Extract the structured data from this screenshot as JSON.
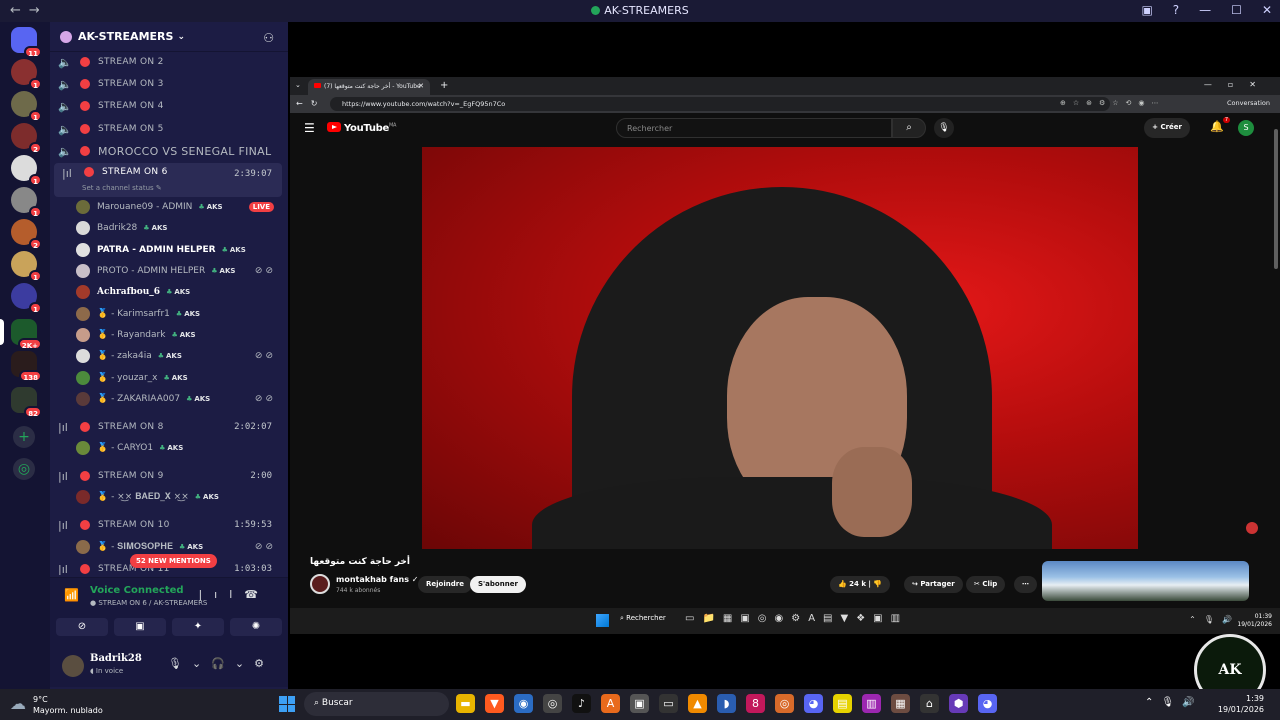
{
  "window": {
    "title": "AK-STREAMERS"
  },
  "rail": {
    "servers": [
      {
        "badge": "11"
      },
      {
        "badge": "1"
      },
      {
        "badge": "1"
      },
      {
        "badge": "2"
      },
      {
        "badge": "1"
      },
      {
        "badge": "1"
      },
      {
        "badge": "2"
      },
      {
        "badge": "1"
      },
      {
        "badge": "1"
      },
      {
        "badge": "2K+"
      },
      {
        "badge": "138"
      },
      {
        "badge": "82"
      }
    ]
  },
  "sidebar": {
    "guild_name": "AK-STREAMERS",
    "channels_top": [
      "STREAM ON 2",
      "STREAM ON 3",
      "STREAM ON 4",
      "STREAM ON 5",
      "MOROCCO VS SENEGAL FINAL"
    ],
    "active_channel": {
      "name": "STREAM ON 6",
      "time": "2:39:07",
      "status_hint": "Set a channel status"
    },
    "users_ch6": [
      {
        "name": "Marouane09 - ADMIN",
        "tag": "AKS",
        "live": "LIVE"
      },
      {
        "name": "Badrik28",
        "tag": "AKS"
      },
      {
        "name": "PATRA - ADMIN HELPER",
        "tag": "AKS"
      },
      {
        "name": "PROTO - ADMIN HELPER",
        "tag": "AKS"
      },
      {
        "name": "Achrafbou_6",
        "tag": "AKS"
      },
      {
        "name": "🥇 - Karimsarfr1",
        "tag": "AKS"
      },
      {
        "name": "🥇 - Rayandark",
        "tag": "AKS"
      },
      {
        "name": "🥇 - zaka4ia",
        "tag": "AKS"
      },
      {
        "name": "🥇 - youzar_x",
        "tag": "AKS"
      },
      {
        "name": "🥇 - ZAKARIAA007",
        "tag": "AKS"
      }
    ],
    "ch8": {
      "name": "STREAM ON 8",
      "time": "2:02:07",
      "user": "🥇 - CARYO1",
      "tag": "AKS"
    },
    "ch9": {
      "name": "STREAM ON 9",
      "time": "2:00",
      "user": "🥇 - ×͜× 𝐁𝐀𝐄𝐃_𝐗 ×͜×",
      "tag": "AKS"
    },
    "ch10": {
      "name": "STREAM ON 10",
      "time": "1:59:53",
      "user": "🥇 - 𝐒𝐈𝐌𝐎𝐒𝐎𝐏𝐇𝐄",
      "tag": "AKS"
    },
    "ch11": {
      "name": "STREAM ON 11",
      "time": "1:03:03"
    },
    "mentions": "52 NEW MENTIONS"
  },
  "voice": {
    "title": "Voice Connected",
    "subtitle": "STREAM ON 6 / AK-STREAMERS",
    "username": "Badrik28",
    "status": "In voice"
  },
  "browser": {
    "tab_title": "(7) أخر حاجة كنت متوقعها - YouTube",
    "url": "https://www.youtube.com/watch?v=_EgFQ95n7Co",
    "conversation": "Conversation"
  },
  "youtube": {
    "logo": "YouTube",
    "country": "MA",
    "search_placeholder": "Rechercher",
    "create": "Créer",
    "notif_count": "7",
    "avatar_letter": "S",
    "video_title": "أخر حاجة كنت متوقعها",
    "channel_name": "montakhab fans",
    "subscribers": "744 k abonnés",
    "join": "Rejoindre",
    "subscribe": "S'abonner",
    "likes": "24 k",
    "share": "Partager",
    "clip": "Clip"
  },
  "inner_taskbar": {
    "search": "Rechercher",
    "time": "01:39",
    "date": "19/01/2026"
  },
  "taskbar": {
    "temp": "9°C",
    "weather": "Mayorm. nublado",
    "search": "Buscar",
    "time": "1:39",
    "date": "19/01/2026"
  },
  "logo_overlay": "AK"
}
